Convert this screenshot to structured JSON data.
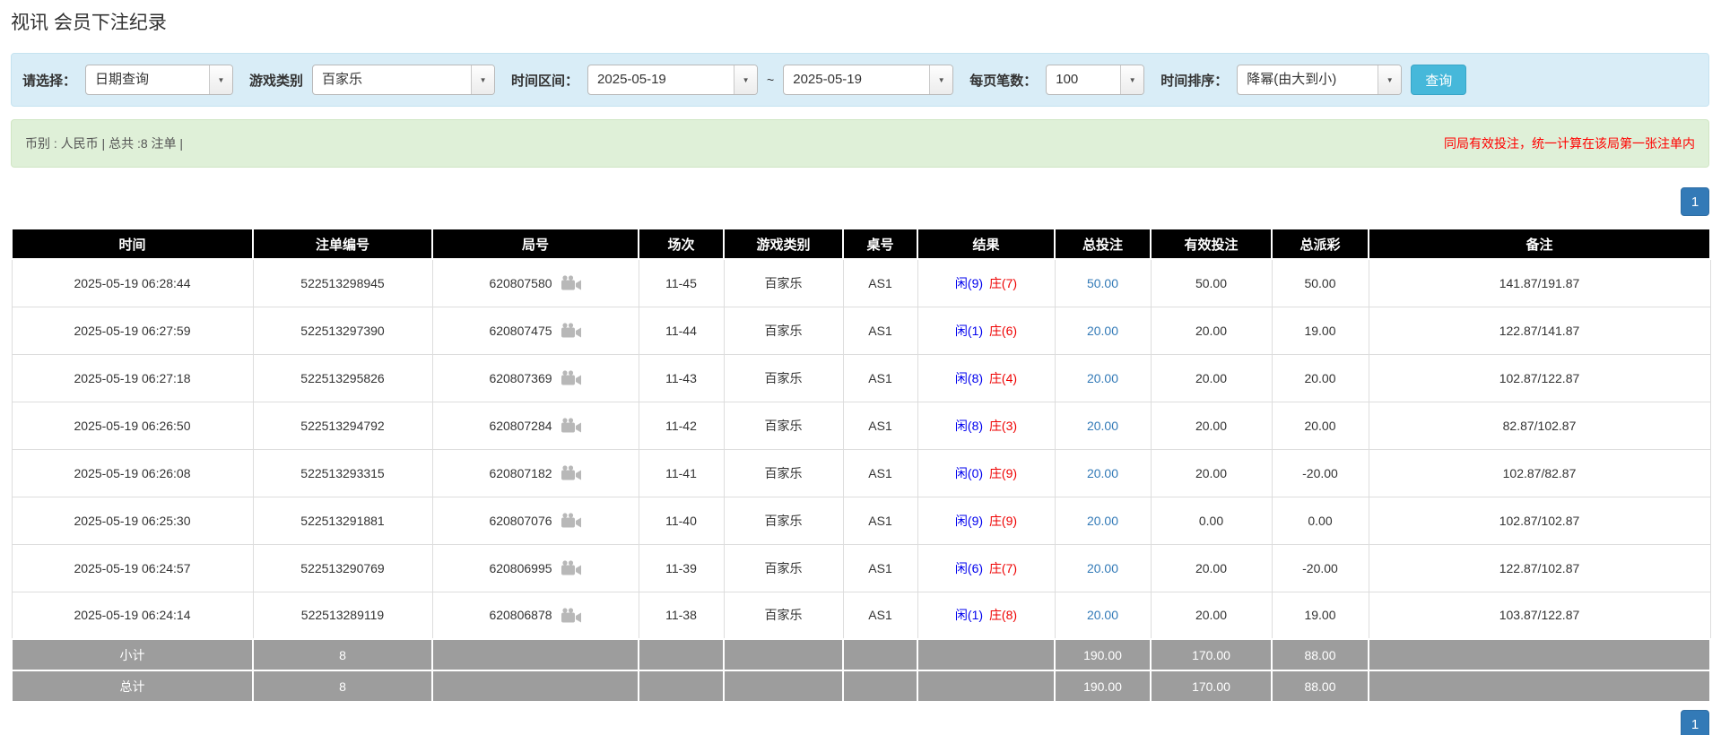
{
  "page": {
    "title": "视讯 会员下注纪录"
  },
  "filters": {
    "select_label": "请选择：",
    "select_value": "日期查询",
    "game_type_label": "游戏类别",
    "game_type_value": "百家乐",
    "time_range_label": "时间区间：",
    "date_from": "2025-05-19",
    "range_separator": "~",
    "date_to": "2025-05-19",
    "page_size_label": "每页笔数：",
    "page_size_value": "100",
    "sort_label": "时间排序：",
    "sort_value": "降幂(由大到小)",
    "query_button": "查询"
  },
  "summary": {
    "left": "币别 : 人民币 | 总共 :8 注单 |",
    "note": "同局有效投注，统一计算在该局第一张注单内"
  },
  "pagination": {
    "current_page": "1"
  },
  "icons": {
    "combo_arrow": "▼",
    "video_icon": "video-camera"
  },
  "colors": {
    "accent_blue": "#337ab7",
    "player_blue": "#0000ee",
    "banker_red": "#ee0000",
    "negative_red": "#ff0000",
    "header_black": "#000000",
    "footer_gray": "#9d9d9d",
    "filter_bg": "#d9edf7",
    "summary_bg": "#dff0d8",
    "query_button_bg": "#46b8da"
  },
  "table": {
    "headers": [
      "时间",
      "注单编号",
      "局号",
      "场次",
      "游戏类别",
      "桌号",
      "结果",
      "总投注",
      "有效投注",
      "总派彩",
      "备注"
    ],
    "rows": [
      {
        "time": "2025-05-19 06:28:44",
        "bet_id": "522513298945",
        "round_id": "620807580",
        "session": "11-45",
        "game": "百家乐",
        "table_no": "AS1",
        "result_player": "闲(9)",
        "result_banker": "庄(7)",
        "total_bet": "50.00",
        "valid_bet": "50.00",
        "payout": "50.00",
        "remark": "141.87/191.87"
      },
      {
        "time": "2025-05-19 06:27:59",
        "bet_id": "522513297390",
        "round_id": "620807475",
        "session": "11-44",
        "game": "百家乐",
        "table_no": "AS1",
        "result_player": "闲(1)",
        "result_banker": "庄(6)",
        "total_bet": "20.00",
        "valid_bet": "20.00",
        "payout": "19.00",
        "remark": "122.87/141.87"
      },
      {
        "time": "2025-05-19 06:27:18",
        "bet_id": "522513295826",
        "round_id": "620807369",
        "session": "11-43",
        "game": "百家乐",
        "table_no": "AS1",
        "result_player": "闲(8)",
        "result_banker": "庄(4)",
        "total_bet": "20.00",
        "valid_bet": "20.00",
        "payout": "20.00",
        "remark": "102.87/122.87"
      },
      {
        "time": "2025-05-19 06:26:50",
        "bet_id": "522513294792",
        "round_id": "620807284",
        "session": "11-42",
        "game": "百家乐",
        "table_no": "AS1",
        "result_player": "闲(8)",
        "result_banker": "庄(3)",
        "total_bet": "20.00",
        "valid_bet": "20.00",
        "payout": "20.00",
        "remark": "82.87/102.87"
      },
      {
        "time": "2025-05-19 06:26:08",
        "bet_id": "522513293315",
        "round_id": "620807182",
        "session": "11-41",
        "game": "百家乐",
        "table_no": "AS1",
        "result_player": "闲(0)",
        "result_banker": "庄(9)",
        "total_bet": "20.00",
        "valid_bet": "20.00",
        "payout": "-20.00",
        "remark": "102.87/82.87"
      },
      {
        "time": "2025-05-19 06:25:30",
        "bet_id": "522513291881",
        "round_id": "620807076",
        "session": "11-40",
        "game": "百家乐",
        "table_no": "AS1",
        "result_player": "闲(9)",
        "result_banker": "庄(9)",
        "total_bet": "20.00",
        "valid_bet": "0.00",
        "payout": "0.00",
        "remark": "102.87/102.87"
      },
      {
        "time": "2025-05-19 06:24:57",
        "bet_id": "522513290769",
        "round_id": "620806995",
        "session": "11-39",
        "game": "百家乐",
        "table_no": "AS1",
        "result_player": "闲(6)",
        "result_banker": "庄(7)",
        "total_bet": "20.00",
        "valid_bet": "20.00",
        "payout": "-20.00",
        "remark": "122.87/102.87"
      },
      {
        "time": "2025-05-19 06:24:14",
        "bet_id": "522513289119",
        "round_id": "620806878",
        "session": "11-38",
        "game": "百家乐",
        "table_no": "AS1",
        "result_player": "闲(1)",
        "result_banker": "庄(8)",
        "total_bet": "20.00",
        "valid_bet": "20.00",
        "payout": "19.00",
        "remark": "103.87/122.87"
      }
    ],
    "footer": [
      {
        "label": "小计",
        "count": "8",
        "total_bet": "190.00",
        "valid_bet": "170.00",
        "payout": "88.00"
      },
      {
        "label": "总计",
        "count": "8",
        "total_bet": "190.00",
        "valid_bet": "170.00",
        "payout": "88.00"
      }
    ]
  }
}
